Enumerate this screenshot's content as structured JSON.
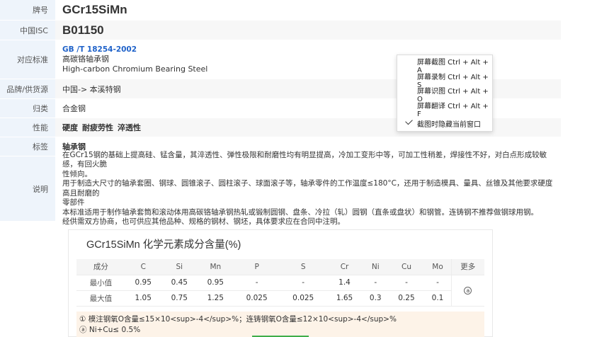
{
  "spec": {
    "grade_label": "牌号",
    "grade": "GCr15SiMn",
    "isc_label": "中国ISC",
    "isc": "B01150",
    "standard_label": "对应标准",
    "standard_code": "GB /T 18254-2002",
    "standard_cn": "高碳铬轴承钢",
    "standard_en": "High-carbon Chromium Bearing Steel",
    "brand_label": "品牌/供货源",
    "brand": "中国-> 本溪特钢",
    "class_label": "归类",
    "class": "合金钢",
    "perf_label": "性能",
    "perf": [
      "硬度",
      "耐疲劳性",
      "淬透性"
    ],
    "tag_label": "标签",
    "tag": "轴承钢",
    "desc_label": "说明",
    "desc": [
      "在GCr15钢的基础上提高硅、锰含量，其淬透性、弹性极限和耐磨性均有明显提高，冷加工变形中等，可加工性稍差，焊接性不好，对白点形成较敏感，有回火脆",
      "性倾向。",
      "用于制造大尺寸的轴承套圈、钢球、圆锥滚子、圆柱滚子、球面滚子等，轴承零件的工作温度≤180°C，还用于制造模具、量具、丝锥及其他要求硬度高且耐磨的",
      "零部件",
      "本标准适用于制作轴承套筒和滚动体用高碳铬轴承钢热轧或锻制圆钢、盘条、冷拉（轧）圆钢（直条或盘状）和钢管。连铸钢不推荐做钢球用钢。",
      "经供需双方协商，也可供应其他品种、规格的钢材、钢坯，具体要求应在合同中注明。"
    ]
  },
  "composition": {
    "title": "GCr15SiMn 化学元素成分含量(%)",
    "header": [
      "成分",
      "C",
      "Si",
      "Mn",
      "P",
      "S",
      "Cr",
      "Ni",
      "Cu",
      "Mo",
      "更多"
    ],
    "rows": [
      {
        "label": "最小值",
        "values": [
          "0.95",
          "0.45",
          "0.95",
          "-",
          "-",
          "1.4",
          "-",
          "-",
          "-"
        ]
      },
      {
        "label": "最大值",
        "values": [
          "1.05",
          "0.75",
          "1.25",
          "0.025",
          "0.025",
          "1.65",
          "0.3",
          "0.25",
          "0.1"
        ]
      }
    ],
    "more_mark": "ⓐ",
    "notes": [
      "① 模注钢氧O含量≤15×10<sup>-4</sup>%；连铸钢氧O含量≤12×10<sup>-4</sup>%",
      "ⓐ Ni+Cu≤ 0.5%"
    ]
  },
  "context_menu": {
    "items": [
      {
        "label": "屏幕截图 Ctrl + Alt + A",
        "checked": false
      },
      {
        "label": "屏幕录制 Ctrl + Alt + S",
        "checked": false
      },
      {
        "label": "屏幕识图 Ctrl + Alt + O",
        "checked": false
      },
      {
        "label": "屏幕翻译 Ctrl + Alt + F",
        "checked": false
      },
      {
        "label": "截图时隐藏当前窗口",
        "checked": true
      }
    ]
  }
}
